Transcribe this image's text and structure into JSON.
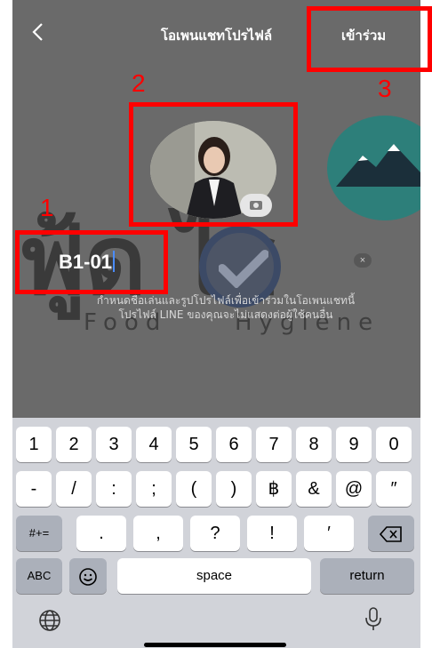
{
  "header": {
    "title": "โอเพนแชทโปรไฟล์",
    "join_label": "เข้าร่วม"
  },
  "background_logo": {
    "thai_text": "ฟู้ด ไฮ",
    "eng_left": "Food",
    "eng_right": "Hygiene"
  },
  "profile": {
    "name_value": "B1-01",
    "clear_symbol": "×",
    "helper_line1": "กำหนดชื่อเล่นและรูปโปรไฟล์เพื่อเข้าร่วมในโอเพนแชทนี้",
    "helper_line2": "โปรไฟล์ LINE ของคุณจะไม่แสดงต่อผู้ใช้คนอื่น"
  },
  "annotations": [
    "1",
    "2",
    "3"
  ],
  "keyboard": {
    "row1": [
      "1",
      "2",
      "3",
      "4",
      "5",
      "6",
      "7",
      "8",
      "9",
      "0"
    ],
    "row2": [
      "-",
      "/",
      ":",
      ";",
      "(",
      ")",
      "฿",
      "&",
      "@",
      "″"
    ],
    "row3_left": "#+=",
    "row3": [
      ".",
      ",",
      "?",
      "!",
      "′"
    ],
    "abc": "ABC",
    "space": "space",
    "return": "return"
  },
  "colors": {
    "annotation_red": "#ff0000",
    "caret_blue": "#4a8cff",
    "keyboard_bg": "#d1d3d9"
  }
}
